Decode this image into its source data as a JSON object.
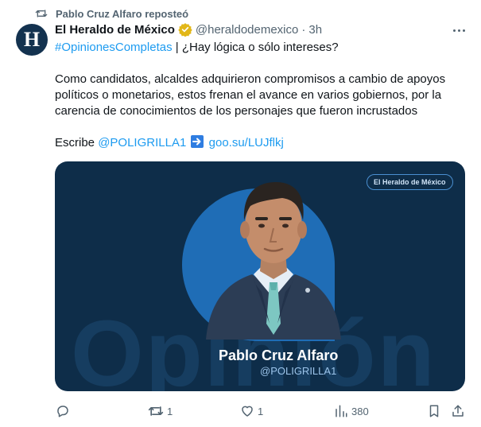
{
  "repost": {
    "icon": "repost-icon",
    "text": "Pablo Cruz Alfaro reposteó"
  },
  "author": {
    "avatar_letter": "H",
    "name": "El Heraldo de México",
    "verified_icon": "gold-verified-badge-icon",
    "handle": "@heraldodemexico",
    "separator": "·",
    "time": "3h"
  },
  "tweet": {
    "hashtag": "#OpinionesCompletas",
    "line1_rest": " | ¿Hay lógica o sólo intereses?",
    "body": "Como candidatos, alcaldes adquirieron compromisos a cambio de apoyos políticos o monetarios, estos frenan el avance en varios gobiernos, por la carencia de conocimientos de los personajes que fueron incrustados",
    "escribe": "Escribe ",
    "mention": "@POLIGRILLA1",
    "arrow_icon": "right-arrow-emoji-icon",
    "url": "goo.su/LUJflkj"
  },
  "media": {
    "brand": "El Heraldo de México",
    "background_word": "Opinión",
    "caption_name": "Pablo Cruz Alfaro",
    "caption_handle": "@POLIGRILLA1",
    "colors": {
      "background": "#0e2d49",
      "circle": "#1f6db6"
    }
  },
  "actions": {
    "reply": {
      "icon": "reply-icon",
      "count": ""
    },
    "repost": {
      "icon": "repost-icon",
      "count": "1"
    },
    "like": {
      "icon": "heart-icon",
      "count": "1"
    },
    "views": {
      "icon": "views-chart-icon",
      "count": "380"
    },
    "bookmark": {
      "icon": "bookmark-icon"
    },
    "share": {
      "icon": "share-icon"
    }
  },
  "colors": {
    "text": "#0f1419",
    "muted": "#536471",
    "link": "#1d9bf0"
  }
}
